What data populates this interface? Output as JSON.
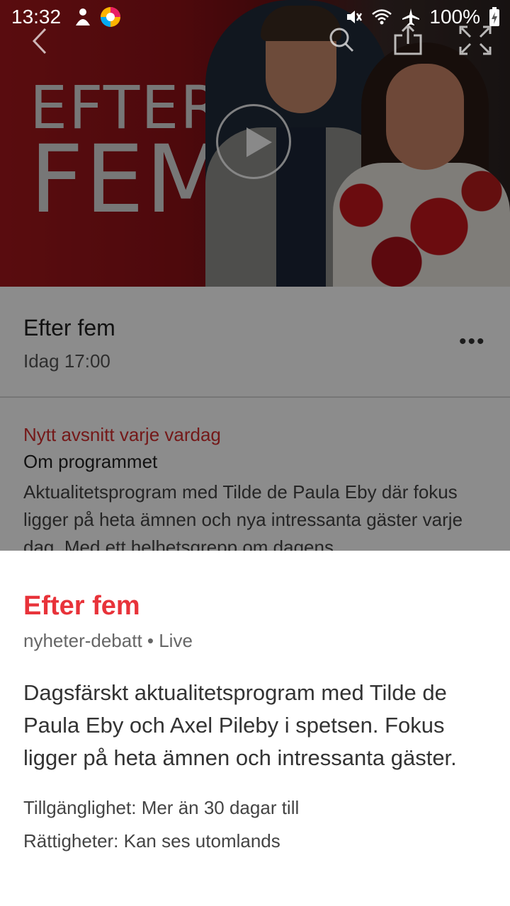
{
  "status": {
    "time": "13:32",
    "battery": "100%"
  },
  "hero": {
    "logo_line1": "EFTER",
    "logo_line2": "FEM"
  },
  "episode": {
    "title": "Efter fem",
    "time": "Idag 17:00",
    "more": "•••"
  },
  "info": {
    "tagline": "Nytt avsnitt varje vardag",
    "about_heading": "Om programmet",
    "description": "Aktualitetsprogram med Tilde de Paula Eby där fokus ligger på heta ämnen och nya intressanta gäster varje dag. Med ett helhetsgrepp om dagens"
  },
  "sheet": {
    "title": "Efter fem",
    "meta": "nyheter-debatt • Live",
    "description": "Dagsfärskt aktualitetsprogram med Tilde de Paula Eby och Axel Pileby i spetsen. Fokus ligger på heta ämnen och intressanta gäster.",
    "availability": "Tillgänglighet: Mer än 30 dagar till",
    "rights": "Rättigheter: Kan ses utomlands"
  },
  "colors": {
    "accent": "#e8333a",
    "tagline": "#d32f2f"
  }
}
